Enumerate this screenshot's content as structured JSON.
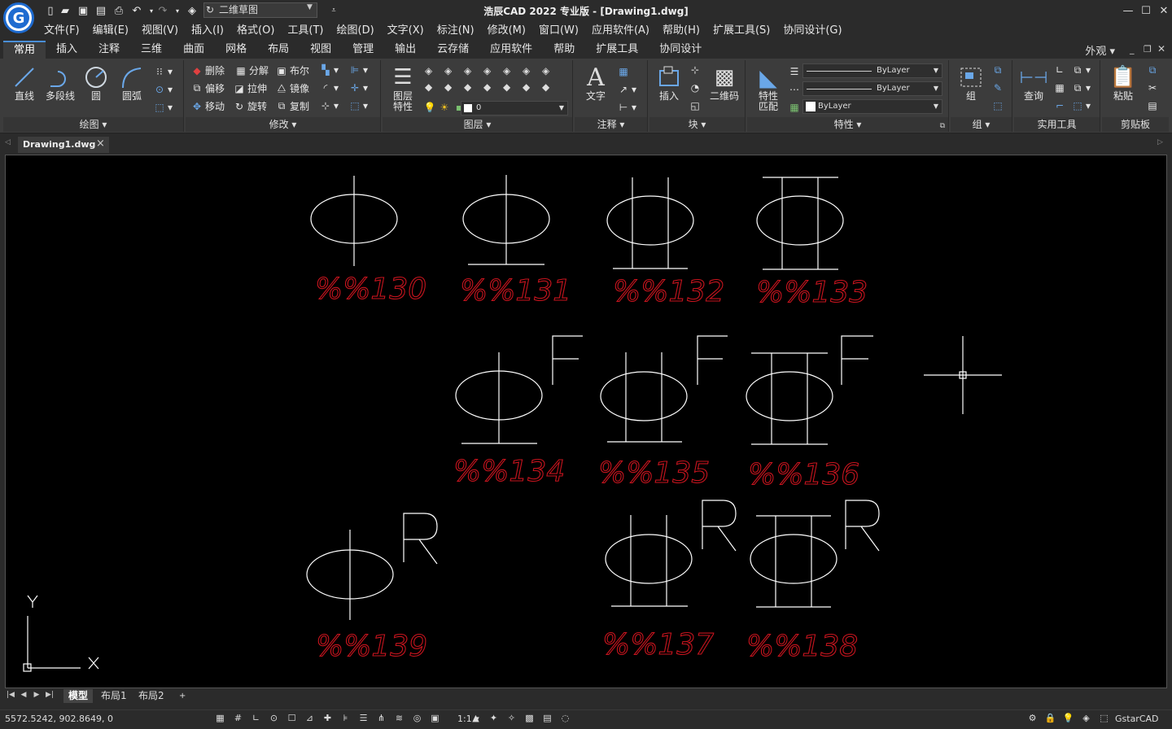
{
  "app": {
    "title": "浩辰CAD 2022 专业版 - [Drawing1.dwg]",
    "logo_letter": "G",
    "workspace": "二维草图"
  },
  "menu": [
    "文件(F)",
    "编辑(E)",
    "视图(V)",
    "插入(I)",
    "格式(O)",
    "工具(T)",
    "绘图(D)",
    "文字(X)",
    "标注(N)",
    "修改(M)",
    "窗口(W)",
    "应用软件(A)",
    "帮助(H)",
    "扩展工具(S)",
    "协同设计(G)"
  ],
  "ribbon_tabs": [
    "常用",
    "插入",
    "注释",
    "三维",
    "曲面",
    "网格",
    "布局",
    "视图",
    "管理",
    "输出",
    "云存储",
    "应用软件",
    "帮助",
    "扩展工具",
    "协同设计"
  ],
  "ribbon_tab_active": "常用",
  "ribbon_right": "外观",
  "panels": {
    "draw": {
      "title": "绘图",
      "line": "直线",
      "polyline": "多段线",
      "circle": "圆",
      "arc": "圆弧"
    },
    "modify": {
      "title": "修改",
      "erase": "删除",
      "explode": "分解",
      "boolean": "布尔",
      "offset": "偏移",
      "stretch": "拉伸",
      "mirror": "镜像",
      "move": "移动",
      "rotate": "旋转",
      "copy": "复制"
    },
    "layers": {
      "title": "图层",
      "props_line1": "图层",
      "props_line2": "特性",
      "current_layer": "0"
    },
    "annotation": {
      "title": "注释",
      "text": "文字"
    },
    "block": {
      "title": "块",
      "insert": "插入",
      "qrcode": "二维码"
    },
    "properties": {
      "title": "特性",
      "match_line1": "特性",
      "match_line2": "匹配",
      "color": "ByLayer",
      "linetype": "ByLayer",
      "lineweight": "ByLayer"
    },
    "group": {
      "title": "组",
      "group": "组"
    },
    "utilities": {
      "title": "实用工具",
      "query": "查询"
    },
    "clipboard": {
      "title": "剪贴板",
      "paste": "粘贴"
    }
  },
  "document_tab": "Drawing1.dwg",
  "drawing": {
    "labels": [
      "%%130",
      "%%131",
      "%%132",
      "%%133",
      "%%134",
      "%%135",
      "%%136",
      "%%139",
      "%%137",
      "%%138"
    ],
    "superscripts": [
      "F",
      "F",
      "F",
      "R",
      "R",
      "R"
    ],
    "ucs_x": "X",
    "ucs_y": "Y",
    "label_color": "#c8141e",
    "line_color": "#ffffff"
  },
  "layout_tabs": [
    "模型",
    "布局1",
    "布局2",
    "+"
  ],
  "layout_active": "模型",
  "status": {
    "coordinates": "5572.5242, 902.8649, 0",
    "scale": "1:1",
    "brand": "GstarCAD"
  }
}
